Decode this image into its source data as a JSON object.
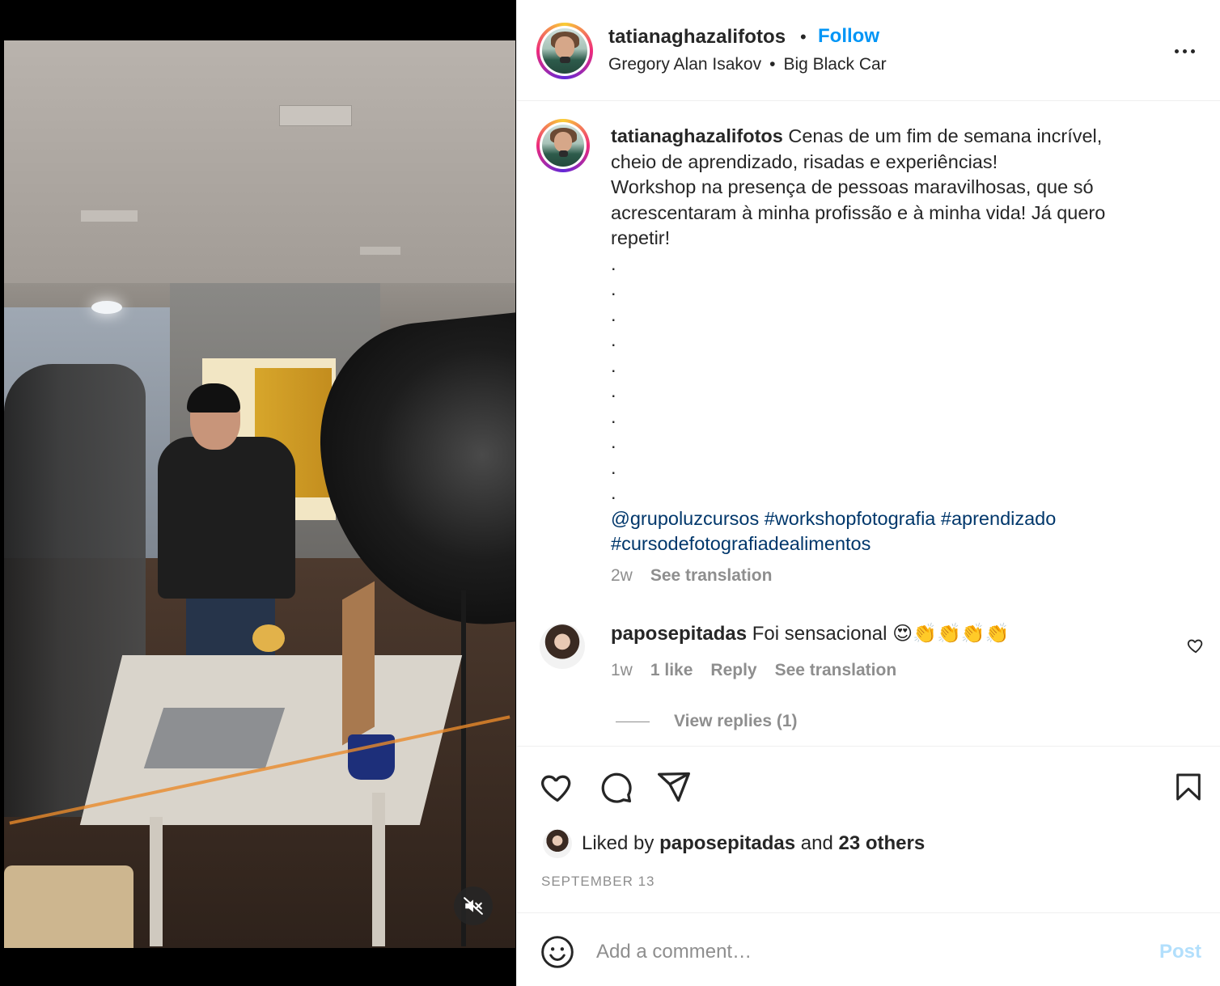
{
  "header": {
    "username": "tatianaghazalifotos",
    "separator": "•",
    "follow_label": "Follow",
    "audio_artist": "Gregory Alan Isakov",
    "audio_separator": "•",
    "audio_track": "Big Black Car"
  },
  "caption": {
    "username": "tatianaghazalifotos",
    "line1": "Cenas de um fim de semana incrível,",
    "line2": "cheio de aprendizado, risadas e experiências!",
    "line3": "Workshop na presença de pessoas maravilhosas, que só",
    "line4": "acrescentaram à minha profissão e à minha vida! Já quero",
    "line5": "repetir!",
    "dots": [
      ".",
      ".",
      ".",
      ".",
      ".",
      ".",
      ".",
      ".",
      ".",
      "."
    ],
    "tags_line1": "@grupoluzcursos #workshopfotografia #aprendizado",
    "tags_line2": "#cursodefotografiadealimentos",
    "time": "2w",
    "see_translation": "See translation"
  },
  "comment": {
    "username": "paposepitadas",
    "text": "Foi sensacional 😍👏👏👏👏",
    "time": "1w",
    "likes": "1 like",
    "reply": "Reply",
    "see_translation": "See translation",
    "view_replies": "View replies (1)"
  },
  "likes": {
    "prefix": "Liked by",
    "user": "paposepitadas",
    "middle": "and",
    "others": "23 others"
  },
  "date": "SEPTEMBER 13",
  "comment_box": {
    "placeholder": "Add a comment…",
    "post_label": "Post"
  },
  "colors": {
    "accent": "#0095f6",
    "hashtag": "#00376b",
    "muted": "#8e8e8e",
    "post_disabled": "#b2dffc"
  },
  "icons": {
    "more": "more-options-icon",
    "mute": "audio-muted-icon",
    "heart": "heart-icon",
    "comment": "comment-icon",
    "share": "share-icon",
    "bookmark": "bookmark-icon",
    "emoji": "emoji-icon"
  }
}
